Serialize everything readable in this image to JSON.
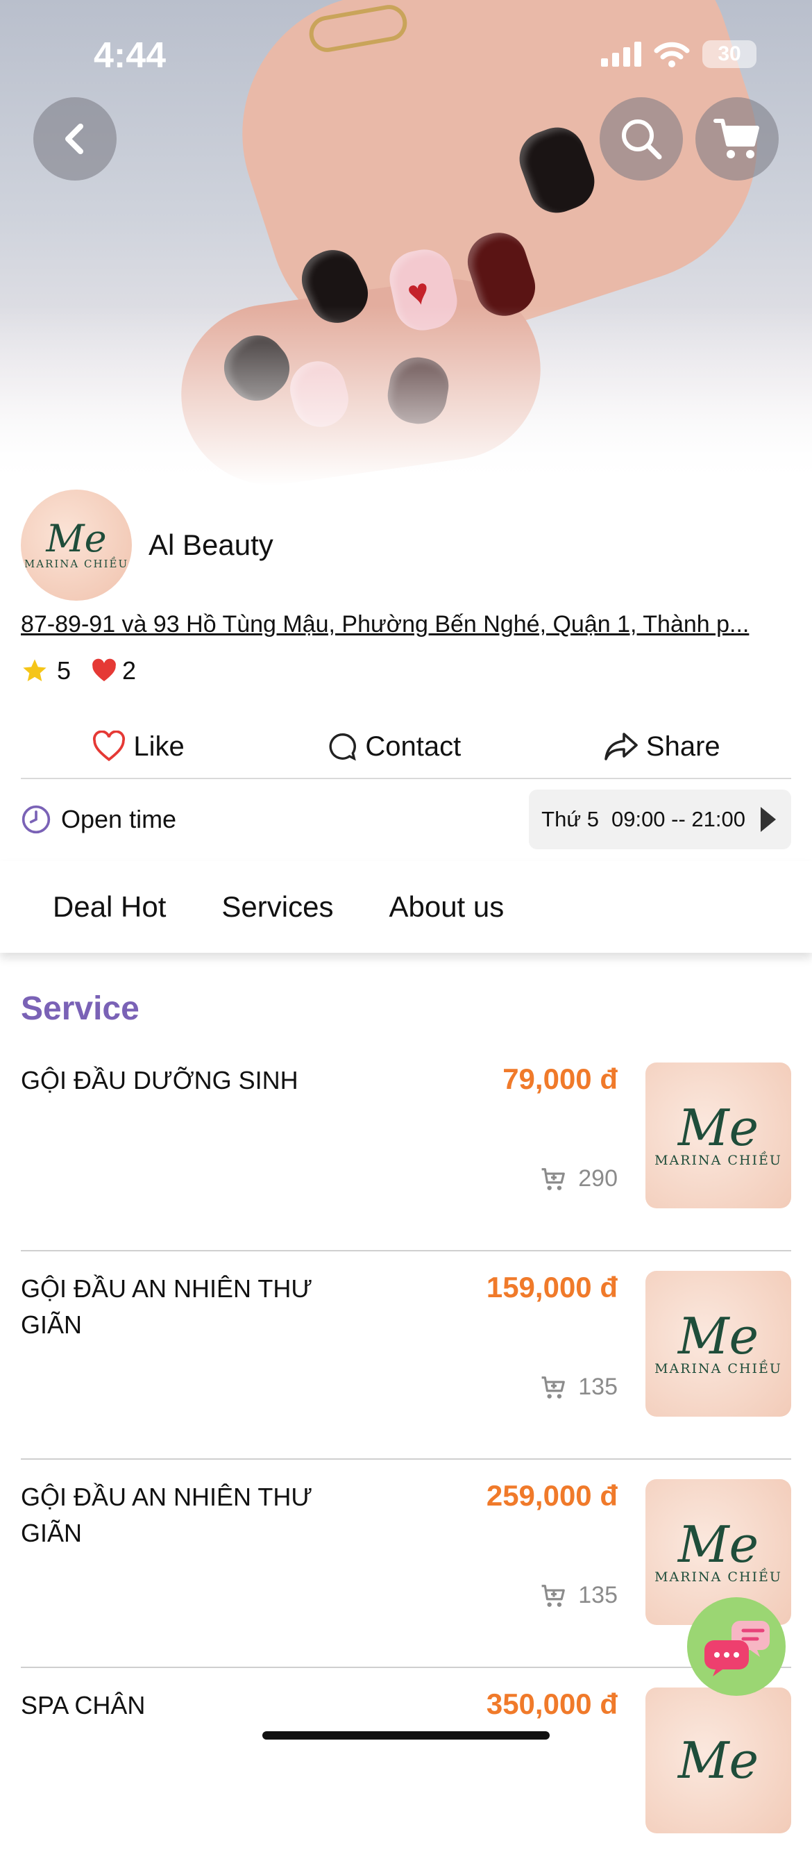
{
  "status_bar": {
    "time": "4:44",
    "battery": "30"
  },
  "shop": {
    "name": "Al Beauty",
    "logo_mark": "Me",
    "logo_name": "MARINA CHIỀU",
    "address": "87-89-91 và 93 Hồ Tùng Mậu, Phường Bến Nghé, Quận 1, Thành p...",
    "rating": "5",
    "likes": "2"
  },
  "actions": {
    "like": "Like",
    "contact": "Contact",
    "share": "Share"
  },
  "open_time": {
    "label": "Open time",
    "day": "Thứ 5",
    "hours": "09:00 -- 21:00"
  },
  "tabs": [
    "Deal Hot",
    "Services",
    "About us"
  ],
  "section_title": "Service",
  "services": [
    {
      "name": "GỘI ĐẦU DƯỠNG SINH",
      "price": "79,000 đ",
      "sold": "290"
    },
    {
      "name": "GỘI ĐẦU AN NHIÊN THƯ GIÃN",
      "price": "159,000 đ",
      "sold": "135"
    },
    {
      "name": "GỘI ĐẦU AN NHIÊN THƯ GIÃN",
      "price": "259,000 đ",
      "sold": "135"
    },
    {
      "name": "SPA CHÂN",
      "price": "350,000 đ",
      "sold": ""
    }
  ],
  "colors": {
    "accent_purple": "#7a62b6",
    "price_orange": "#f07a2a",
    "like_red": "#e53935",
    "star_yellow": "#f5c518",
    "chat_green": "#9bd673"
  },
  "icons": [
    "back-icon",
    "search-icon",
    "cart-icon",
    "star-icon",
    "heart-icon",
    "chat-bubble-icon",
    "share-icon",
    "clock-icon",
    "chevron-right-icon",
    "cart-sold-icon",
    "chat-fab-icon"
  ]
}
